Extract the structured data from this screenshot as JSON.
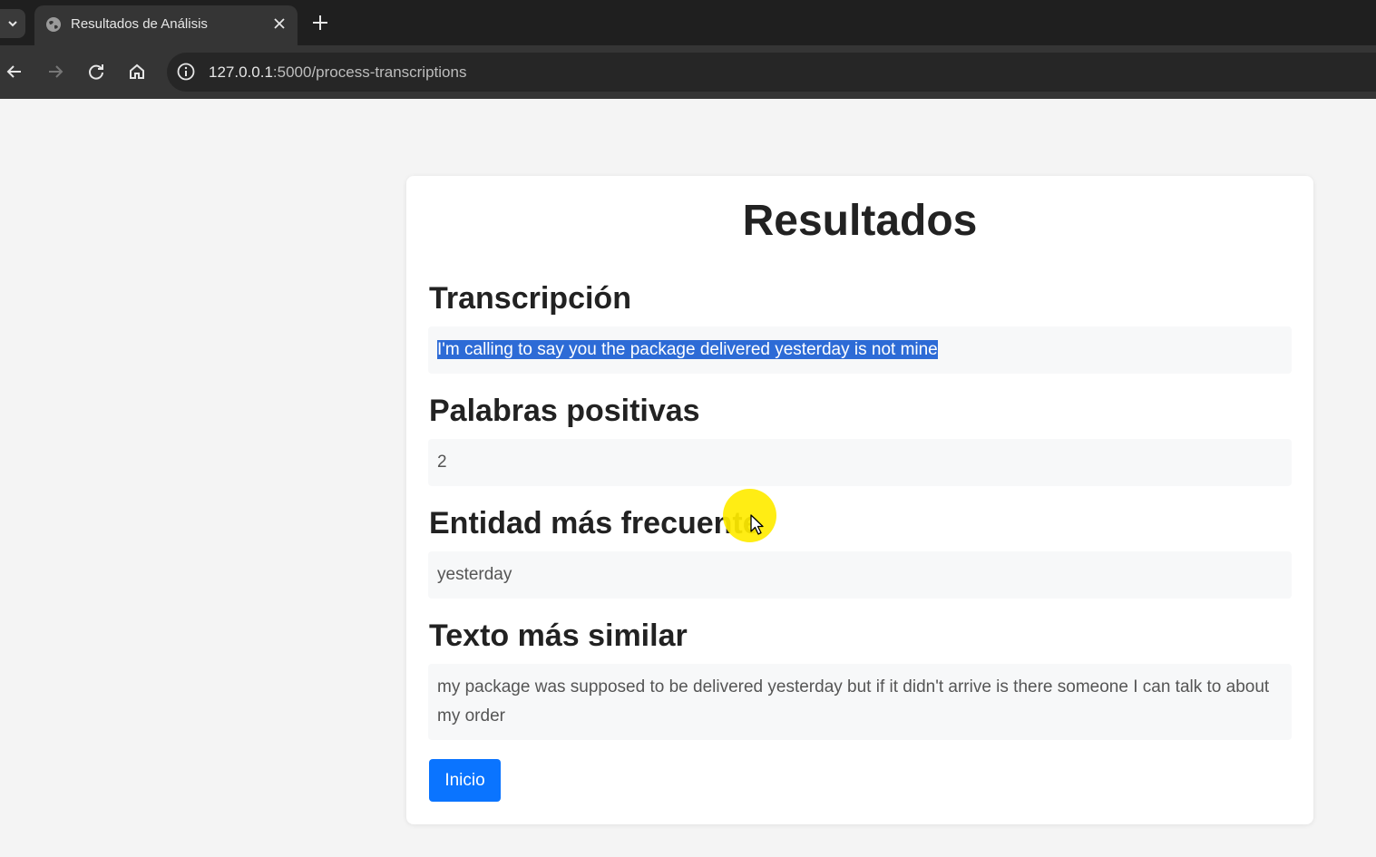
{
  "browser": {
    "tab": {
      "title": "Resultados de Análisis"
    },
    "address": {
      "host": "127.0.0.1",
      "path": ":5000/process-transcriptions"
    }
  },
  "page": {
    "title": "Resultados",
    "sections": [
      {
        "heading": "Transcripción",
        "value": "I'm calling to say you the package delivered yesterday is not mine"
      },
      {
        "heading": "Palabras positivas",
        "value": "2"
      },
      {
        "heading": "Entidad más frecuente",
        "value": "yesterday"
      },
      {
        "heading": "Texto más similar",
        "value": "my package was supposed to be delivered yesterday but if it didn't arrive is there someone I can talk to about my order"
      }
    ],
    "button": {
      "label": "Inicio"
    }
  },
  "colors": {
    "accent": "#0a74ff",
    "selection": "#2d6bd6",
    "cursor_highlight": "#ffeb00"
  }
}
